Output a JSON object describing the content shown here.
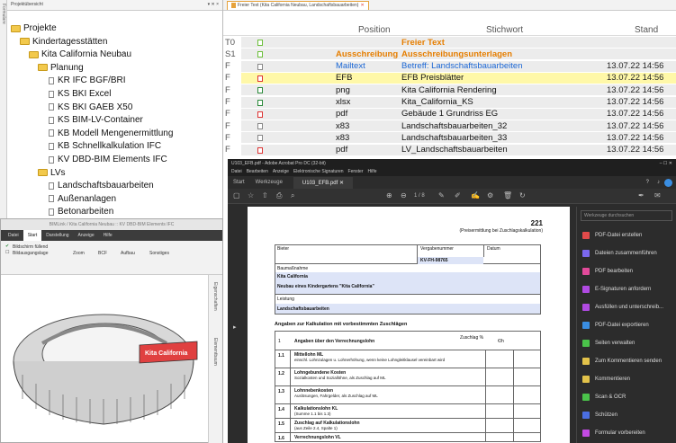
{
  "left_strip": {
    "label": "Formulare"
  },
  "project_panel": {
    "title": "Projektübersicht",
    "controls": "▾ ✕ ×",
    "tree": [
      {
        "label": "Projekte",
        "type": "folder"
      },
      {
        "label": "Kindertagesstätten",
        "type": "folder"
      },
      {
        "label": "Kita California Neubau",
        "type": "folder"
      },
      {
        "label": "Planung",
        "type": "folder"
      },
      {
        "label": "KR IFC BGF/BRI",
        "type": "doc"
      },
      {
        "label": "KS BKI Excel",
        "type": "doc"
      },
      {
        "label": "KS BKI GAEB X50",
        "type": "doc"
      },
      {
        "label": "KS BIM-LV-Container",
        "type": "doc"
      },
      {
        "label": "KB Modell Mengenermittlung",
        "type": "doc"
      },
      {
        "label": "KB Schnellkalkulation IFC",
        "type": "doc"
      },
      {
        "label": "KV DBD-BIM Elements IFC",
        "type": "doc"
      },
      {
        "label": "LVs",
        "type": "folder"
      },
      {
        "label": "Landschaftsbauarbeiten",
        "type": "doc"
      },
      {
        "label": "Außenanlagen",
        "type": "doc"
      },
      {
        "label": "Betonarbeiten",
        "type": "doc"
      },
      {
        "label": "Dachabdichtungsarbeiten",
        "type": "doc"
      }
    ]
  },
  "viewer": {
    "title": "BIMLink / Kita California Neubau :: KV DBD-BIM Elements IFC",
    "tabs": [
      "Datei",
      "Start",
      "Darstellung",
      "Anzeige",
      "Hilfe"
    ],
    "ribbon_top": [
      "Bildschirm füllend",
      "Bildausgangslage"
    ],
    "ribbon_items": [
      "Zoom",
      "BCF",
      "Aufbau",
      "Sonstiges"
    ],
    "side_tabs": [
      "Eigenschaften",
      "Elementbaum"
    ],
    "building_label": "Kita California"
  },
  "table": {
    "tab_label": "Freier Text (Kita California Neubau, Landschaftsbauarbeiten)",
    "headers": {
      "position": "Position",
      "stichwort": "Stichwort",
      "stand": "Stand"
    },
    "rows": [
      {
        "a": "T0",
        "pos": "",
        "stich": "Freier Text",
        "stand": "",
        "color": "#e67e00",
        "bold": true,
        "bg": "#ececec",
        "icon": "#6bbf3a"
      },
      {
        "a": "S1",
        "pos": "Ausschreibung",
        "stich": "Ausschreibungsunterlagen",
        "stand": "",
        "color": "#e67e00",
        "bold": true,
        "bg": "#ececec",
        "icon": "#6bbf3a"
      },
      {
        "a": "F",
        "pos": "Mailtext",
        "stich": "Betreff: Landschaftsbauarbeiten",
        "stand": "13.07.22 14:56",
        "color": "#1a66d4",
        "bold": false,
        "bg": "#ececec",
        "icon": "#888"
      },
      {
        "a": "F",
        "pos": "EFB",
        "stich": "EFB Preisblätter",
        "stand": "13.07.22 14:56",
        "color": "#111",
        "bold": false,
        "bg": "#fff8a8",
        "icon": "#d33"
      },
      {
        "a": "F",
        "pos": "png",
        "stich": "Kita California Rendering",
        "stand": "13.07.22 14:56",
        "color": "#111",
        "bold": false,
        "bg": "#ececec",
        "icon": "#2a8a3a"
      },
      {
        "a": "F",
        "pos": "xlsx",
        "stich": "Kita_California_KS",
        "stand": "13.07.22 14:56",
        "color": "#111",
        "bold": false,
        "bg": "#ececec",
        "icon": "#2a8a3a"
      },
      {
        "a": "F",
        "pos": "pdf",
        "stich": "Gebäude 1 Grundriss EG",
        "stand": "13.07.22 14:56",
        "color": "#111",
        "bold": false,
        "bg": "#ececec",
        "icon": "#d33"
      },
      {
        "a": "F",
        "pos": "x83",
        "stich": "Landschaftsbauarbeiten_32",
        "stand": "13.07.22 14:56",
        "color": "#111",
        "bold": false,
        "bg": "#ececec",
        "icon": "#888"
      },
      {
        "a": "F",
        "pos": "x83",
        "stich": "Landschaftsbauarbeiten_33",
        "stand": "13.07.22 14:56",
        "color": "#111",
        "bold": false,
        "bg": "#ececec",
        "icon": "#888"
      },
      {
        "a": "F",
        "pos": "pdf",
        "stich": "LV_Landschaftsbauarbeiten",
        "stand": "13.07.22 14:56",
        "color": "#111",
        "bold": false,
        "bg": "#ececec",
        "icon": "#d33"
      }
    ]
  },
  "acrobat": {
    "title": "U103_EFB.pdf - Adobe Acrobat Pro DC (32-bit)",
    "window_controls": "–  ☐  ✕",
    "menu": [
      "Datei",
      "Bearbeiten",
      "Anzeige",
      "Elektronische Signaturen",
      "Fenster",
      "Hilfe"
    ],
    "tabs": [
      "Start",
      "Werkzeuge",
      "U103_EFB.pdf"
    ],
    "page_indicator": "1 / 8",
    "search_placeholder": "Werkzeuge durchsuchen",
    "tools": [
      {
        "label": "PDF-Datei erstellen",
        "color": "#e24a4a"
      },
      {
        "label": "Dateien zusammenführen",
        "color": "#7b68ee"
      },
      {
        "label": "PDF bearbeiten",
        "color": "#e24a9a"
      },
      {
        "label": "E-Signaturen anfordern",
        "color": "#b04ae2"
      },
      {
        "label": "Ausfüllen und unterschreib...",
        "color": "#b04ae2"
      },
      {
        "label": "PDF-Datei exportieren",
        "color": "#3a8ee2"
      },
      {
        "label": "Seiten verwalten",
        "color": "#4ac24a"
      },
      {
        "label": "Zum Kommentieren senden",
        "color": "#e2c24a"
      },
      {
        "label": "Kommentieren",
        "color": "#e2c24a"
      },
      {
        "label": "Scan & OCR",
        "color": "#4ac24a"
      },
      {
        "label": "Schützen",
        "color": "#4a6ee2"
      },
      {
        "label": "Formular vorbereiten",
        "color": "#c24ae2"
      }
    ]
  },
  "pdf": {
    "number": "221",
    "subtitle": "(Preisermittlung bei Zuschlagskalkulation)",
    "bieter": "Bieter",
    "vergabenummer_label": "Vergabenummer",
    "vergabenummer": "KV-FH-98765",
    "datum": "Datum",
    "baumassnahme": "Baumaßnahme",
    "baumassnahme_1": "Kita California",
    "baumassnahme_2": "Neubau eines Kindergartens \"Kita California\"",
    "leistung": "Leistung",
    "leistung_val": "Landschaftsbauarbeiten",
    "section": "Angaben zur Kalkulation mit vorbestimmten Zuschlägen",
    "col_angaben": "Angaben über den Verrechnungslohn",
    "col_zuschlag": "Zuschlag %",
    "col_eh": "€/h",
    "rows": [
      {
        "n": "1.1",
        "t": "Mittellohn ML",
        "s": "einschl. Lohnzulagen u. Lohnerhöhung, wenn keine Lohngleitklausel vereinbart wird"
      },
      {
        "n": "1.2",
        "t": "Lohngebundene Kosten",
        "s": "Sozialkosten und Soziallöhne, als Zuschlag auf ML"
      },
      {
        "n": "1.3",
        "t": "Lohnnebenkosten",
        "s": "Auslösungen, Fahrgelder, als Zuschlag auf ML"
      },
      {
        "n": "1.4",
        "t": "Kalkulationslohn KL",
        "s": "(Summe 1.1 bis 1.3)"
      },
      {
        "n": "1.5",
        "t": "Zuschlag auf Kalkulationslohn",
        "s": "(aus Zeile 2.4, Spalte 1)"
      },
      {
        "n": "1.6",
        "t": "Verrechnungslohn VL",
        "s": ""
      }
    ]
  }
}
